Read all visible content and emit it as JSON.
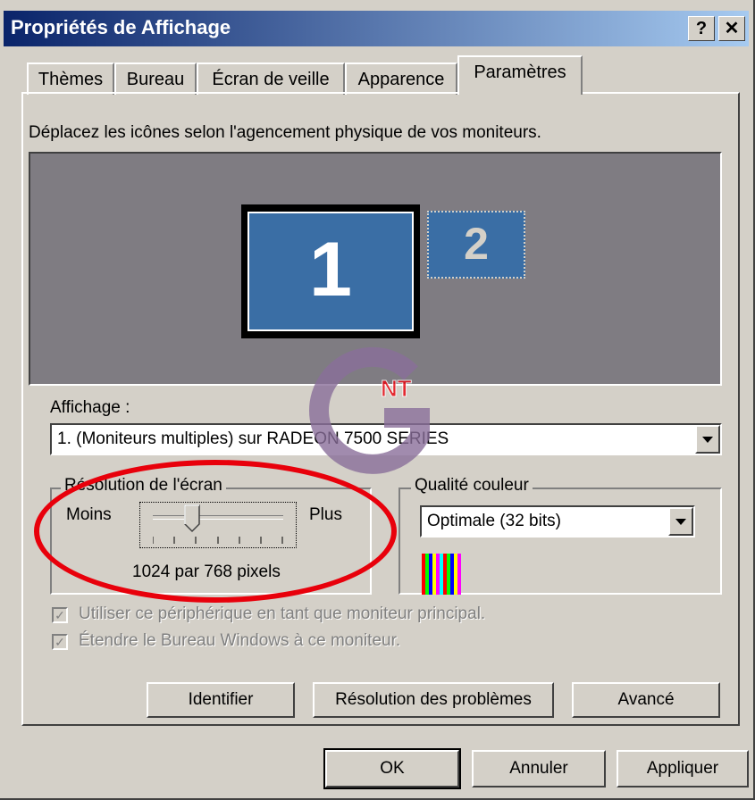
{
  "window": {
    "title": "Propriétés de Affichage",
    "help_label": "?",
    "close_label": "✕"
  },
  "tabs": [
    {
      "label": "Thèmes"
    },
    {
      "label": "Bureau"
    },
    {
      "label": "Écran de veille"
    },
    {
      "label": "Apparence"
    },
    {
      "label": "Paramètres",
      "active": true
    }
  ],
  "settings": {
    "instruction": "Déplacez les icônes selon l'agencement physique de vos moniteurs.",
    "monitors": [
      {
        "label": "1",
        "selected": true
      },
      {
        "label": "2",
        "selected": false
      }
    ],
    "display_label": "Affichage :",
    "display_value": "1. (Moniteurs multiples) sur RADEON 7500 SERIES",
    "resolution": {
      "legend": "Résolution de l'écran",
      "less": "Moins",
      "more": "Plus",
      "value_text": "1024 par 768 pixels",
      "slider_position": 0.3
    },
    "color_quality": {
      "legend": "Qualité couleur",
      "value": "Optimale (32 bits)"
    },
    "checkboxes": [
      {
        "label": "Utiliser ce périphérique en tant que moniteur principal.",
        "checked": true,
        "enabled": false
      },
      {
        "label": "Étendre le Bureau Windows à ce moniteur.",
        "checked": true,
        "enabled": false
      }
    ],
    "buttons": {
      "identify": "Identifier",
      "troubleshoot": "Résolution des problèmes",
      "advanced": "Avancé"
    }
  },
  "footer": {
    "ok": "OK",
    "cancel": "Annuler",
    "apply": "Appliquer"
  },
  "watermark": {
    "text": "NT"
  },
  "colors": {
    "highlight": "#e8000b",
    "title_start": "#0a246a",
    "desktop": "#3a6ea5"
  }
}
